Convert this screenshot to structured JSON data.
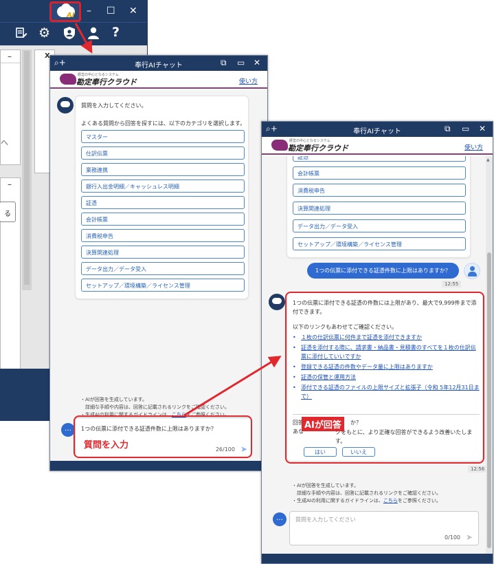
{
  "app": {
    "window_controls": {
      "minimize": "–",
      "maximize": "☐",
      "close": "✕"
    },
    "ai_launcher_label": "AI",
    "toolbar_icons": [
      "document-edit-icon",
      "gear-icon",
      "shield-user-icon",
      "user-icon",
      "help-icon"
    ],
    "left_fragments": {
      "x_label": "X",
      "collapse_a": "–",
      "collapse_b": "–",
      "char_he": "へ",
      "char_ru": "る"
    }
  },
  "chat_left": {
    "title": "奉行AIチャット",
    "logo_sub": "経営の中心となるシステム",
    "logo": "勘定奉行クラウド",
    "howto": "使い方",
    "greeting": "質問を入力してください。",
    "faq_intro": "よくある質問から回答を探すには、以下のカテゴリを選択します。",
    "categories": [
      "マスター",
      "仕訳伝票",
      "業務連携",
      "銀行入出金明細／キャッシュレス明細",
      "証憑",
      "会計帳票",
      "消費税申告",
      "決算関連処理",
      "データ出力／データ受入",
      "セットアップ／環境構築／ライセンス管理"
    ],
    "notes": [
      "・AIが回答を生成しています。",
      "　詳細な手順や内容は、回答に記載されるリンクをご確認ください。",
      "・生成AIの利用に関するガイドラインは、",
      "こちら",
      "をご参照ください。"
    ],
    "input_text": "1つの伝票に添付できる証憑件数に上限はありますか？",
    "counter": "26/100",
    "callout": "質問を入力"
  },
  "chat_right": {
    "title": "奉行AIチャット",
    "logo_sub": "経営の中心となるシステム",
    "logo": "勘定奉行クラウド",
    "howto": "使い方",
    "cut_category": "証憑",
    "categories": [
      "会計帳票",
      "消費税申告",
      "決算関連処理",
      "データ出力／データ受入",
      "セットアップ／環境構築／ライセンス管理"
    ],
    "user_question": "1つの伝票に添付できる証憑件数に上限はありますか？",
    "user_time": "12:55",
    "answer": "1つの伝票に添付できる証憑の件数には上限があり、最大で9,999件まで添付できます。",
    "links_intro": "以下のリンクもあわせてご確認ください。",
    "links": [
      "１枚の仕訳伝票に何件まで証憑を添付できますか",
      "証憑を添付する際に、請求書・納品書・見積書のすべてを１枚の仕訳伝票に添付していいですか",
      "登録できる証憑の件数やデータ量に上限はありますか",
      "証憑の保管と運用方法",
      "添付できる証憑のファイルの上限サイズと拡張子（令和 5年12月31日まで）"
    ],
    "feedback_q_a": "回答",
    "feedback_q_b": "か？",
    "feedback_text_a": "あな",
    "feedback_text_b": "クをもとに、より正確な回答ができるよう改善いたします。",
    "yes": "はい",
    "no": "いいえ",
    "bot_time": "12:56",
    "notes": [
      "・AIが回答を生成しています。",
      "　詳細な手順や内容は、回答に記載されるリンクをご確認ください。",
      "・生成AIの利用に関するガイドラインは、",
      "こちら",
      "をご参照ください。"
    ],
    "input_placeholder": "質問を入力してください",
    "counter": "0/100",
    "callout": "AIが回答"
  },
  "colors": {
    "navy": "#1f3a63",
    "accent_red": "#e0282e",
    "link_blue": "#1a4fb5",
    "user_bubble": "#2f6ad0",
    "brand_purple": "#8a2d78"
  }
}
